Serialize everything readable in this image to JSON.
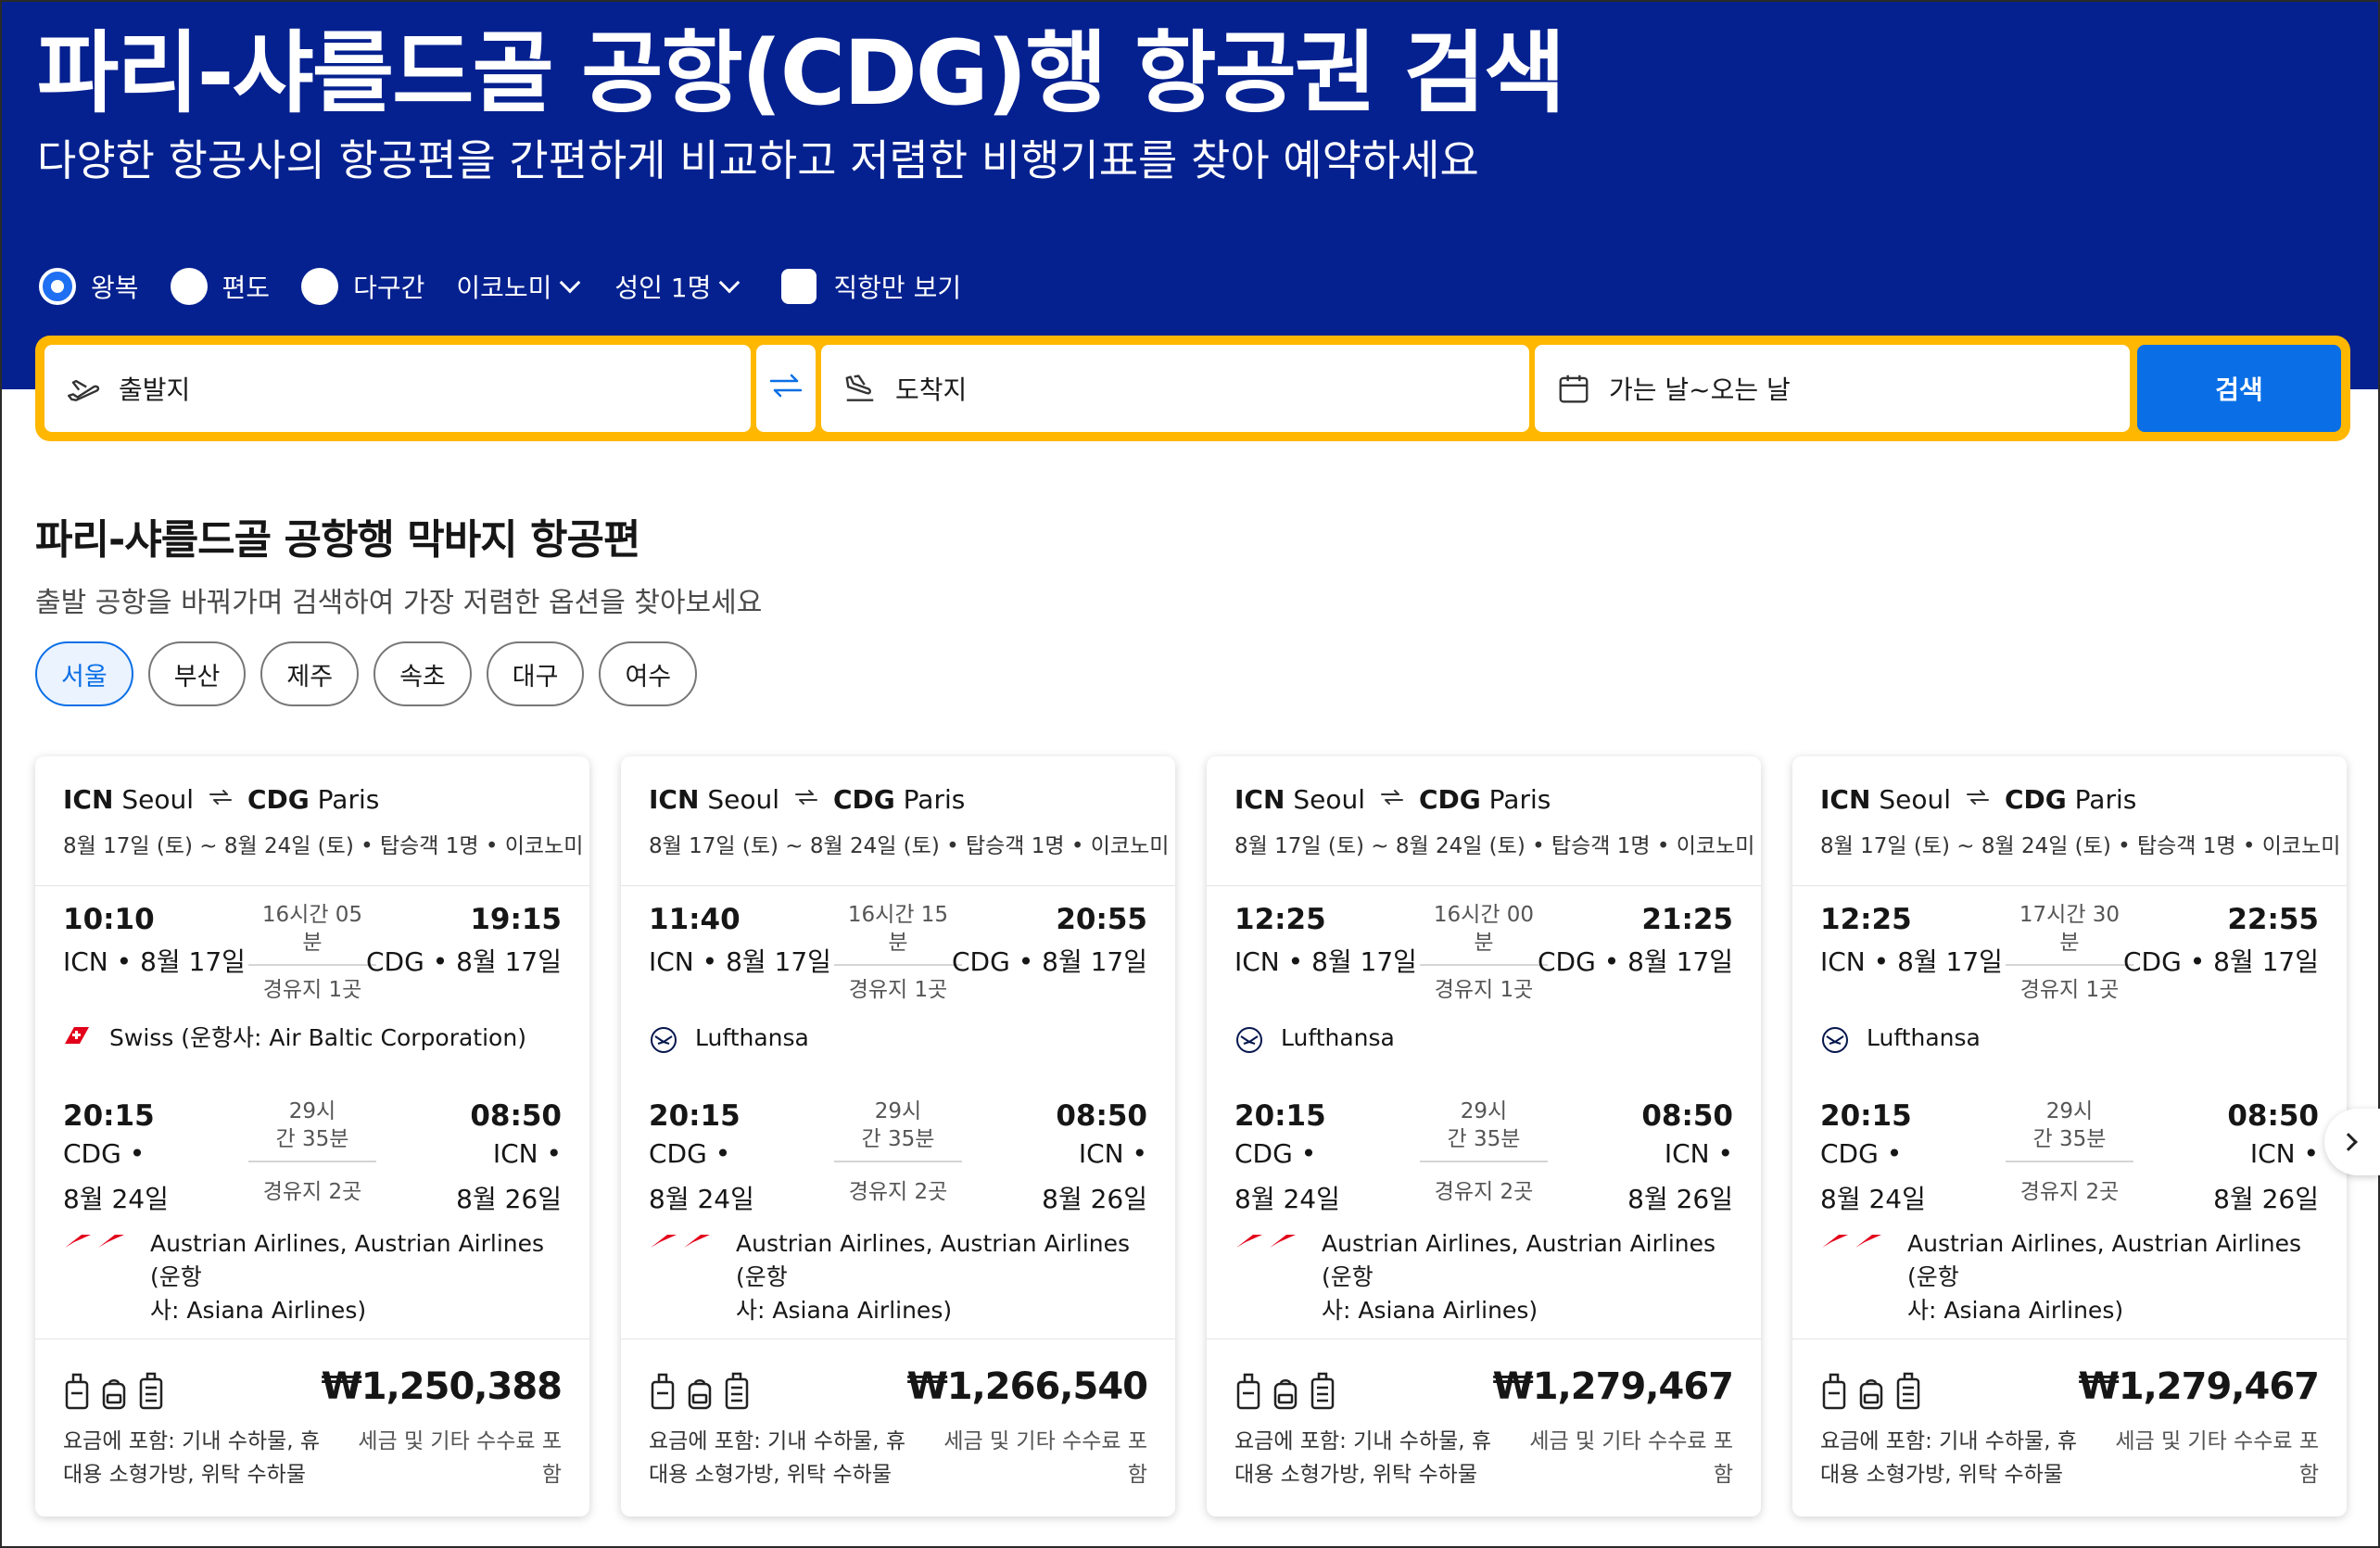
{
  "hero": {
    "title": "파리-샤를드골 공항(CDG)행 항공권 검색",
    "subtitle": "다양한 항공사의 항공편을 간편하게 비교하고 저렴한 비행기표를 찾아 예약하세요"
  },
  "trip_options": {
    "roundtrip": "왕복",
    "oneway": "편도",
    "multicity": "다구간",
    "cabin": "이코노미",
    "travelers": "성인 1명",
    "direct_only": "직항만 보기",
    "selected": "왕복"
  },
  "search": {
    "origin_placeholder": "출발지",
    "destination_placeholder": "도착지",
    "dates_placeholder": "가는 날~오는 날",
    "button": "검색"
  },
  "section": {
    "title": "파리-샤를드골 공항행 막바지 항공편",
    "subtitle": "출발 공항을 바꿔가며 검색하여 가장 저렴한 옵션을 찾아보세요",
    "chips": [
      "서울",
      "부산",
      "제주",
      "속초",
      "대구",
      "여수"
    ],
    "active_chip": "서울"
  },
  "cards": [
    {
      "from_code": "ICN",
      "from_city": "Seoul",
      "to_code": "CDG",
      "to_city": "Paris",
      "meta": "8월 17일 (토) ~ 8월 24일 (토) • 탑승객 1명 • 이코노미",
      "out": {
        "dep": "10:10",
        "dep_place": "ICN • 8월 17일",
        "dur1": "16시간 05",
        "dur2": "분",
        "arr": "19:15",
        "arr_place": "CDG • 8월 17일",
        "stops": "경유지 1곳",
        "airline": "Swiss (운항사: Air Baltic Corporation)",
        "logo": "swiss"
      },
      "ret": {
        "dep": "20:15",
        "dep_place1": "CDG •",
        "dep_place2": "8월 24일",
        "dur1": "29시",
        "dur2": "간 35분",
        "arr": "08:50",
        "arr_place1": "ICN •",
        "arr_place2": "8월 26일",
        "stops": "경유지 2곳",
        "airline1": "Austrian Airlines, Austrian Airlines (운항",
        "airline2": "사: Asiana Airlines)",
        "logo": "austrian"
      },
      "price": "₩1,250,388",
      "included1": "요금에 포함: 기내 수하물, 휴",
      "included2": "대용 소형가방, 위탁 수하물",
      "tax1": "세금 및 기타 수수료 포",
      "tax2": "함"
    },
    {
      "from_code": "ICN",
      "from_city": "Seoul",
      "to_code": "CDG",
      "to_city": "Paris",
      "meta": "8월 17일 (토) ~ 8월 24일 (토) • 탑승객 1명 • 이코노미",
      "out": {
        "dep": "11:40",
        "dep_place": "ICN • 8월 17일",
        "dur1": "16시간 15",
        "dur2": "분",
        "arr": "20:55",
        "arr_place": "CDG • 8월 17일",
        "stops": "경유지 1곳",
        "airline": "Lufthansa",
        "logo": "lufthansa"
      },
      "ret": {
        "dep": "20:15",
        "dep_place1": "CDG •",
        "dep_place2": "8월 24일",
        "dur1": "29시",
        "dur2": "간 35분",
        "arr": "08:50",
        "arr_place1": "ICN •",
        "arr_place2": "8월 26일",
        "stops": "경유지 2곳",
        "airline1": "Austrian Airlines, Austrian Airlines (운항",
        "airline2": "사: Asiana Airlines)",
        "logo": "austrian"
      },
      "price": "₩1,266,540",
      "included1": "요금에 포함: 기내 수하물, 휴",
      "included2": "대용 소형가방, 위탁 수하물",
      "tax1": "세금 및 기타 수수료 포",
      "tax2": "함"
    },
    {
      "from_code": "ICN",
      "from_city": "Seoul",
      "to_code": "CDG",
      "to_city": "Paris",
      "meta": "8월 17일 (토) ~ 8월 24일 (토) • 탑승객 1명 • 이코노미",
      "out": {
        "dep": "12:25",
        "dep_place": "ICN • 8월 17일",
        "dur1": "16시간 00",
        "dur2": "분",
        "arr": "21:25",
        "arr_place": "CDG • 8월 17일",
        "stops": "경유지 1곳",
        "airline": "Lufthansa",
        "logo": "lufthansa"
      },
      "ret": {
        "dep": "20:15",
        "dep_place1": "CDG •",
        "dep_place2": "8월 24일",
        "dur1": "29시",
        "dur2": "간 35분",
        "arr": "08:50",
        "arr_place1": "ICN •",
        "arr_place2": "8월 26일",
        "stops": "경유지 2곳",
        "airline1": "Austrian Airlines, Austrian Airlines (운항",
        "airline2": "사: Asiana Airlines)",
        "logo": "austrian"
      },
      "price": "₩1,279,467",
      "included1": "요금에 포함: 기내 수하물, 휴",
      "included2": "대용 소형가방, 위탁 수하물",
      "tax1": "세금 및 기타 수수료 포",
      "tax2": "함"
    },
    {
      "from_code": "ICN",
      "from_city": "Seoul",
      "to_code": "CDG",
      "to_city": "Paris",
      "meta": "8월 17일 (토) ~ 8월 24일 (토) • 탑승객 1명 • 이코노미",
      "out": {
        "dep": "12:25",
        "dep_place": "ICN • 8월 17일",
        "dur1": "17시간 30",
        "dur2": "분",
        "arr": "22:55",
        "arr_place": "CDG • 8월 17일",
        "stops": "경유지 1곳",
        "airline": "Lufthansa",
        "logo": "lufthansa"
      },
      "ret": {
        "dep": "20:15",
        "dep_place1": "CDG •",
        "dep_place2": "8월 24일",
        "dur1": "29시",
        "dur2": "간 35분",
        "arr": "08:50",
        "arr_place1": "ICN •",
        "arr_place2": "8월 26일",
        "stops": "경유지 2곳",
        "airline1": "Austrian Airlines, Austrian Airlines (운항",
        "airline2": "사: Asiana Airlines)",
        "logo": "austrian"
      },
      "price": "₩1,279,467",
      "included1": "요금에 포함: 기내 수하물, 휴",
      "included2": "대용 소형가방, 위탁 수하물",
      "tax1": "세금 및 기타 수수료 포",
      "tax2": "함"
    }
  ],
  "colors": {
    "hero": "#05218f",
    "accent": "#0a6fe6",
    "search_border": "#ffb700"
  },
  "icons": [
    "plane-takeoff-icon",
    "plane-landing-icon",
    "swap-icon",
    "calendar-icon",
    "chevron-down-icon",
    "chevron-right-icon",
    "personal-item-icon",
    "cabin-bag-icon",
    "checked-bag-icon"
  ]
}
